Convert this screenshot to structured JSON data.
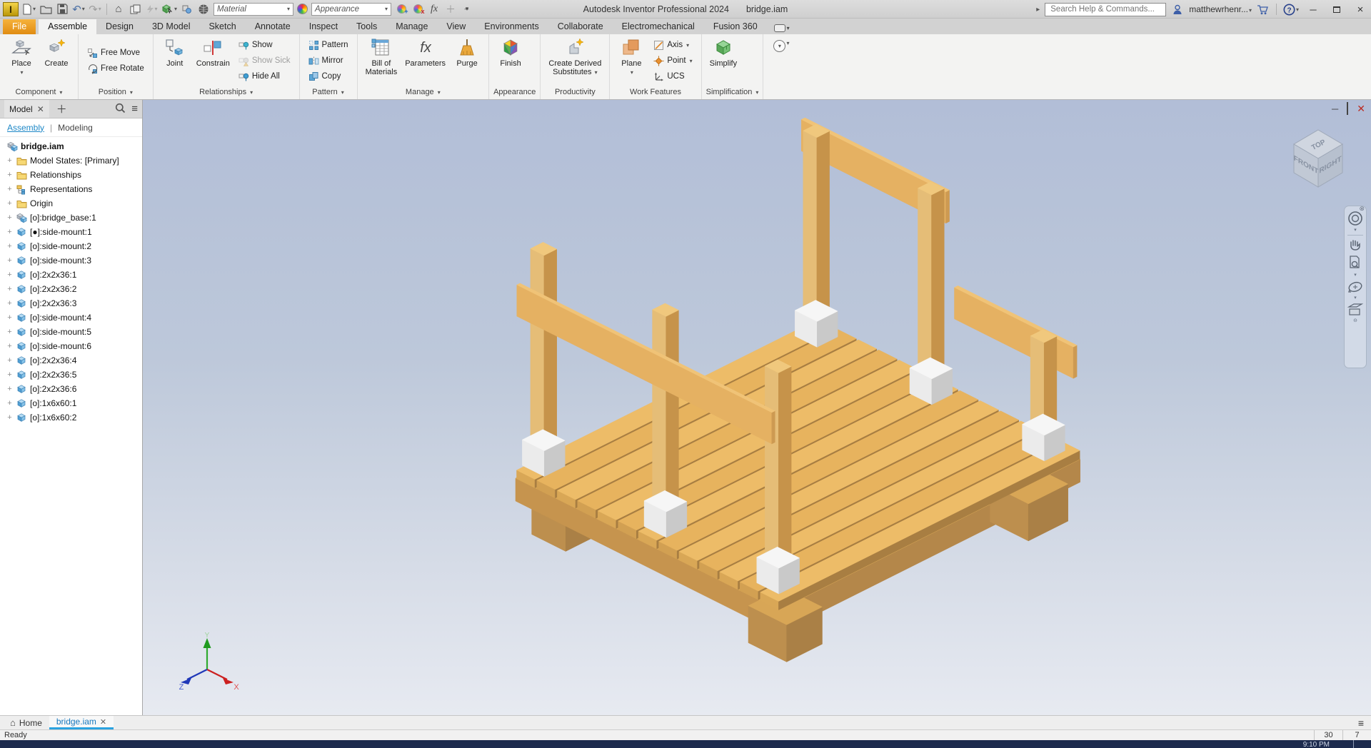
{
  "titlebar": {
    "app_title": "Autodesk Inventor Professional 2024",
    "doc_title": "bridge.iam",
    "material_value": "Material",
    "appearance_value": "Appearance",
    "search_placeholder": "Search Help & Commands...",
    "username": "matthewrhenr..."
  },
  "colors": {
    "accent_blue": "#1e88c7",
    "file_tab_orange": "#e8941f",
    "wood_light": "#edbc68",
    "wood_dark": "#c6934a",
    "viewport_top": "#b2bed7",
    "close_red": "#bb2b22"
  },
  "ribbon": {
    "tabs": [
      {
        "label": "File",
        "style": "file"
      },
      {
        "label": "Assemble",
        "style": "active"
      },
      {
        "label": "Design"
      },
      {
        "label": "3D Model"
      },
      {
        "label": "Sketch"
      },
      {
        "label": "Annotate"
      },
      {
        "label": "Inspect"
      },
      {
        "label": "Tools"
      },
      {
        "label": "Manage"
      },
      {
        "label": "View"
      },
      {
        "label": "Environments"
      },
      {
        "label": "Collaborate"
      },
      {
        "label": "Electromechanical"
      },
      {
        "label": "Fusion 360"
      }
    ],
    "groups": [
      {
        "label": "Component",
        "arrow": true,
        "items": [
          {
            "type": "big",
            "icon": "place",
            "label": [
              "Place"
            ],
            "arrow": "below"
          },
          {
            "type": "big",
            "icon": "create",
            "label": [
              "Create"
            ]
          }
        ]
      },
      {
        "label": "Position",
        "arrow": true,
        "items": [
          {
            "type": "stack",
            "items": [
              {
                "icon": "free-move",
                "label": "Free Move"
              },
              {
                "icon": "free-rotate",
                "label": "Free Rotate"
              }
            ]
          }
        ]
      },
      {
        "label": "Relationships",
        "arrow": true,
        "items": [
          {
            "type": "big",
            "icon": "joint",
            "label": [
              "Joint"
            ]
          },
          {
            "type": "big",
            "icon": "constrain",
            "label": [
              "Constrain"
            ]
          },
          {
            "type": "stack",
            "items": [
              {
                "icon": "show",
                "label": "Show"
              },
              {
                "icon": "show-sick",
                "label": "Show Sick",
                "disabled": true
              },
              {
                "icon": "hide-all",
                "label": "Hide All"
              }
            ]
          }
        ]
      },
      {
        "label": "Pattern",
        "arrow": true,
        "items": [
          {
            "type": "stack",
            "items": [
              {
                "icon": "pattern",
                "label": "Pattern"
              },
              {
                "icon": "mirror",
                "label": "Mirror"
              },
              {
                "icon": "copy",
                "label": "Copy"
              }
            ]
          }
        ]
      },
      {
        "label": "Manage",
        "arrow": true,
        "items": [
          {
            "type": "big",
            "icon": "bom",
            "label": [
              "Bill of",
              "Materials"
            ]
          },
          {
            "type": "big",
            "icon": "parameters",
            "label": [
              "Parameters"
            ]
          },
          {
            "type": "big",
            "icon": "purge",
            "label": [
              "Purge"
            ]
          }
        ]
      },
      {
        "label": "Appearance",
        "arrow": false,
        "items": [
          {
            "type": "big",
            "icon": "finish",
            "label": [
              "Finish"
            ]
          }
        ]
      },
      {
        "label": "Productivity",
        "arrow": false,
        "items": [
          {
            "type": "big",
            "icon": "cds",
            "label": [
              "Create Derived",
              "Substitutes"
            ],
            "arrow": "side"
          }
        ]
      },
      {
        "label": "Work Features",
        "arrow": false,
        "items": [
          {
            "type": "big",
            "icon": "plane",
            "label": [
              "Plane"
            ],
            "arrow": "below"
          },
          {
            "type": "stack",
            "items": [
              {
                "icon": "axis",
                "label": "Axis",
                "arrow": true
              },
              {
                "icon": "point",
                "label": "Point",
                "arrow": true
              },
              {
                "icon": "ucs",
                "label": "UCS"
              }
            ]
          }
        ]
      },
      {
        "label": "Simplification",
        "arrow": true,
        "items": [
          {
            "type": "big",
            "icon": "simplify",
            "label": [
              "Simplify"
            ]
          }
        ]
      }
    ]
  },
  "browser": {
    "tab_label": "Model",
    "subtab_assembly": "Assembly",
    "subtab_modeling": "Modeling",
    "tree": [
      {
        "icon": "assembly",
        "label": "bridge.iam",
        "root": true
      },
      {
        "icon": "folder",
        "label": "Model States: [Primary]"
      },
      {
        "icon": "folder",
        "label": "Relationships"
      },
      {
        "icon": "representations",
        "label": "Representations"
      },
      {
        "icon": "folder",
        "label": "Origin"
      },
      {
        "icon": "subassembly",
        "label": "[o]:bridge_base:1"
      },
      {
        "icon": "part",
        "label": "[●]:side-mount:1"
      },
      {
        "icon": "part",
        "label": "[o]:side-mount:2"
      },
      {
        "icon": "part",
        "label": "[o]:side-mount:3"
      },
      {
        "icon": "part",
        "label": "[o]:2x2x36:1"
      },
      {
        "icon": "part",
        "label": "[o]:2x2x36:2"
      },
      {
        "icon": "part",
        "label": "[o]:2x2x36:3"
      },
      {
        "icon": "part",
        "label": "[o]:side-mount:4"
      },
      {
        "icon": "part",
        "label": "[o]:side-mount:5"
      },
      {
        "icon": "part",
        "label": "[o]:side-mount:6"
      },
      {
        "icon": "part",
        "label": "[o]:2x2x36:4"
      },
      {
        "icon": "part",
        "label": "[o]:2x2x36:5"
      },
      {
        "icon": "part",
        "label": "[o]:2x2x36:6"
      },
      {
        "icon": "part",
        "label": "[o]:1x6x60:1"
      },
      {
        "icon": "part",
        "label": "[o]:1x6x60:2"
      }
    ]
  },
  "viewport": {
    "viewcube": {
      "top": "TOP",
      "front": "FRONT",
      "right": "RIGHT"
    },
    "triad": {
      "x": "X",
      "y": "Y",
      "z": "Z"
    }
  },
  "doctabs": {
    "home_label": "Home",
    "doc_label": "bridge.iam"
  },
  "statusbar": {
    "message": "Ready",
    "field1": "30",
    "field2": "7"
  },
  "taskbar": {
    "clock": "9:10 PM"
  }
}
